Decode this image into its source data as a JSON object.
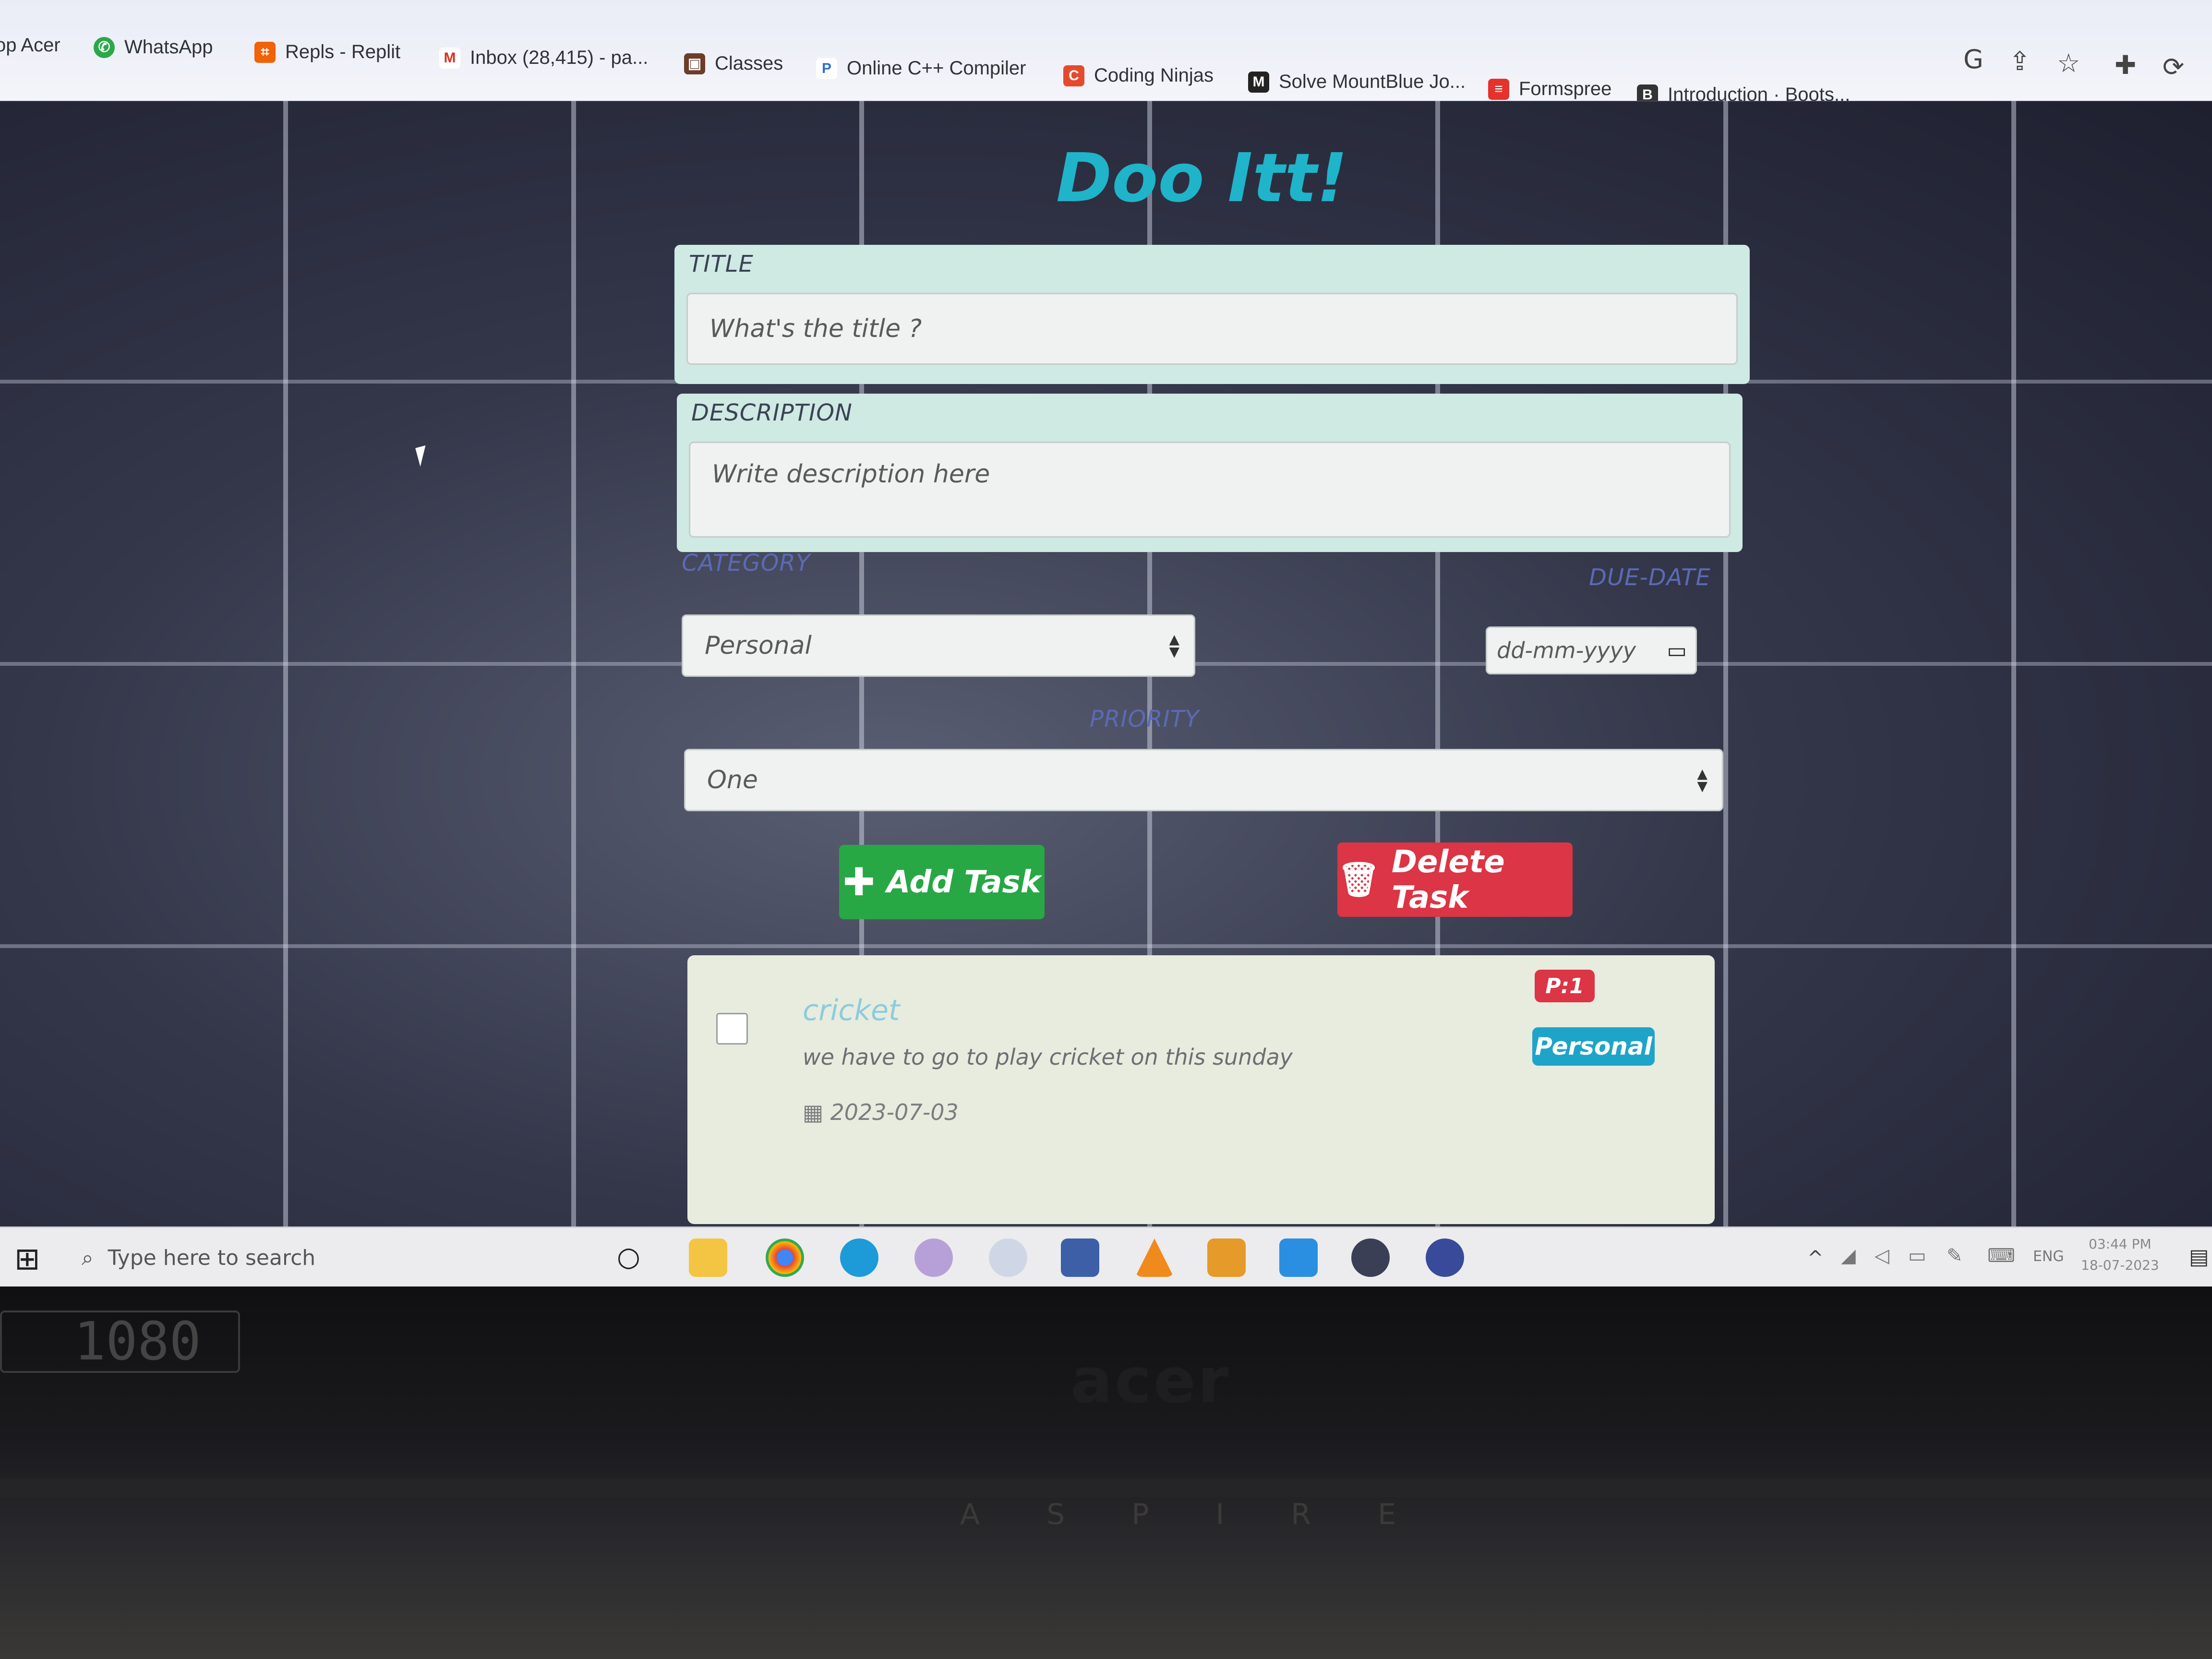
{
  "bookmarks": [
    {
      "label": "op Acer",
      "icon": "acer-icon"
    },
    {
      "label": "WhatsApp",
      "icon": "whatsapp-icon"
    },
    {
      "label": "Repls - Replit",
      "icon": "replit-icon"
    },
    {
      "label": "Inbox (28,415) - pa...",
      "icon": "gmail-icon"
    },
    {
      "label": "Classes",
      "icon": "classes-icon"
    },
    {
      "label": "Online C++ Compiler",
      "icon": "compiler-icon"
    },
    {
      "label": "Coding Ninjas",
      "icon": "coding-ninjas-icon"
    },
    {
      "label": "Solve MountBlue Jo...",
      "icon": "mountblue-icon"
    },
    {
      "label": "Formspree",
      "icon": "formspree-icon"
    },
    {
      "label": "Introduction · Boots...",
      "icon": "bootstrap-icon"
    }
  ],
  "app": {
    "title": "Doo Itt!"
  },
  "form": {
    "title_label": "TITLE",
    "title_placeholder": "What's the title ?",
    "description_label": "DESCRIPTION",
    "description_placeholder": "Write description here",
    "category_label": "CATEGORY",
    "category_value": "Personal",
    "due_label": "DUE-DATE",
    "due_placeholder": "dd-mm-yyyy",
    "priority_label": "PRIORITY",
    "priority_value": "One",
    "add_button": "Add Task",
    "delete_button": "Delete Task"
  },
  "task": {
    "title": "cricket",
    "description": "we have to go to play cricket on this sunday",
    "date": "2023-07-03",
    "priority_badge": "P:1",
    "category_badge": "Personal",
    "checked": false
  },
  "taskbar": {
    "search_placeholder": "Type here to search",
    "language": "ENG",
    "time": "03:44 PM",
    "date": "18-07-2023"
  },
  "bezel": {
    "brand": "acer",
    "series": "A S P I R E",
    "sticker": "1080"
  },
  "colors": {
    "title": "#1fb4c9",
    "add": "#28a745",
    "delete": "#dc3545",
    "info_badge": "#1fa4c9",
    "panel": "#cfe9e3"
  }
}
